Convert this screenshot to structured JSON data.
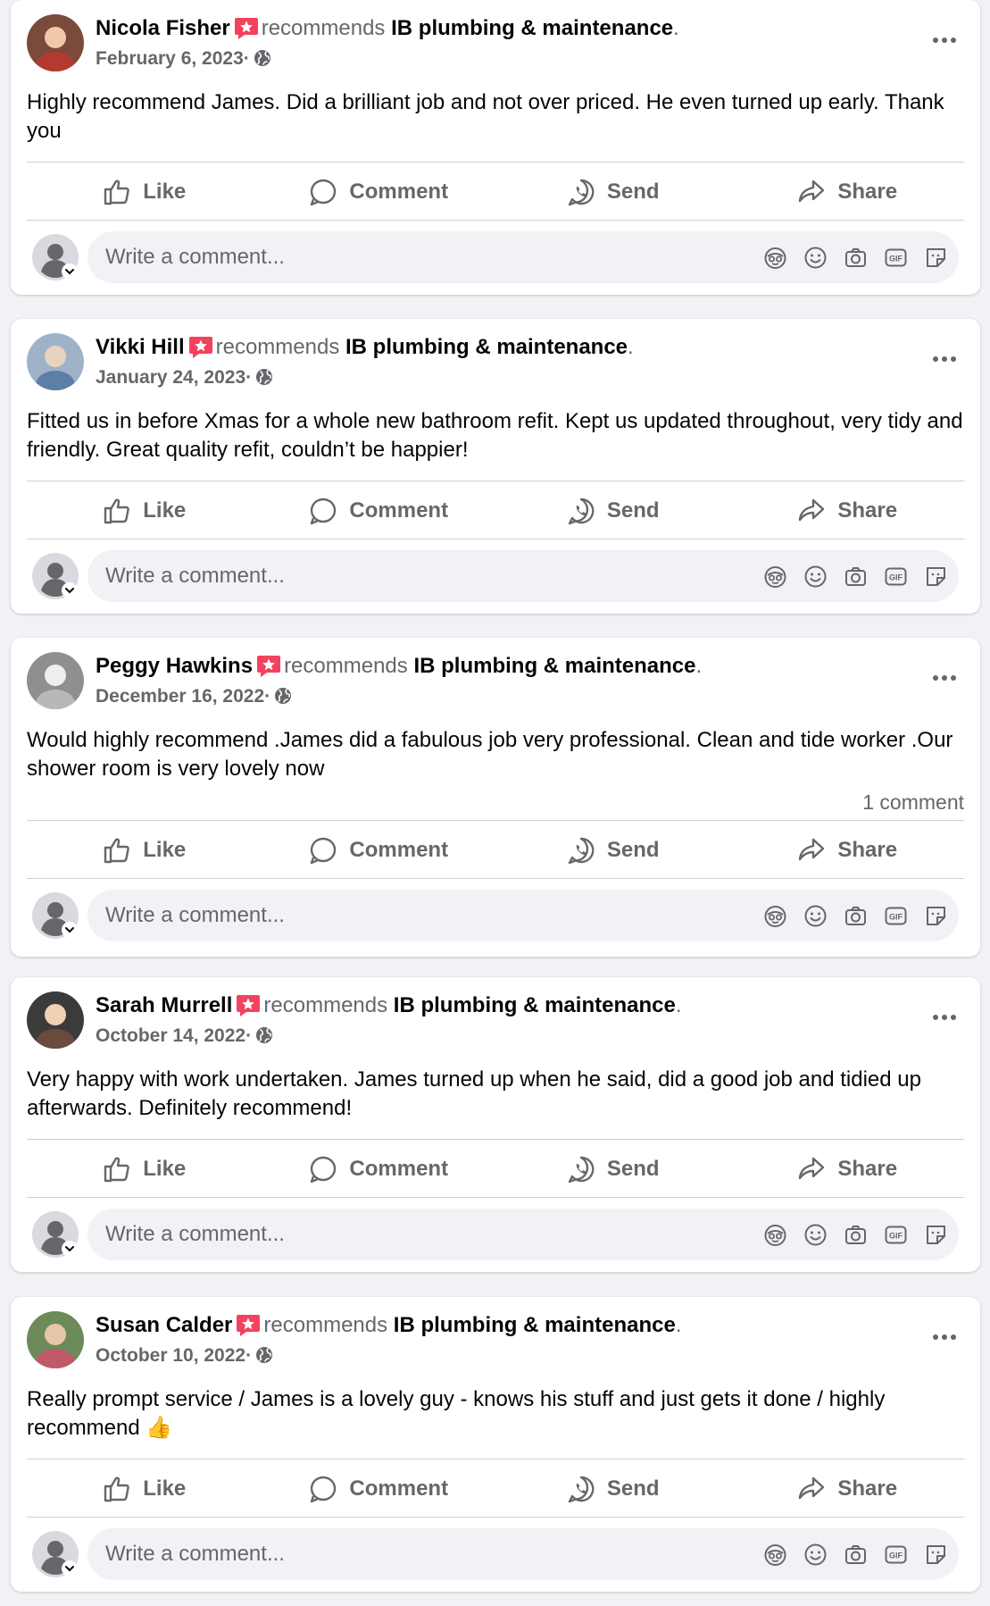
{
  "posts": [
    {
      "author": "Nicola Fisher",
      "verb": "recommends",
      "page": "IB plumbing & maintenance",
      "period": ".",
      "date": "February 6, 2023",
      "date_sep": "·",
      "text": "Highly recommend James. Did a brilliant job  and not over priced. He even turned up early. Thank you",
      "comment_count": "",
      "avatar_icon": "user-photo-icon"
    },
    {
      "author": "Vikki Hill",
      "verb": "recommends",
      "page": "IB plumbing & maintenance",
      "period": ".",
      "date": "January 24, 2023",
      "date_sep": "·",
      "text": "Fitted us in before Xmas for a whole new bathroom refit. Kept us updated throughout, very tidy and friendly. Great quality refit, couldn’t be happier!",
      "comment_count": "",
      "avatar_icon": "user-photo-icon"
    },
    {
      "author": "Peggy Hawkins",
      "verb": "recommends",
      "page": "IB plumbing & maintenance",
      "period": ".",
      "date": "December 16, 2022",
      "date_sep": "·",
      "text": "Would highly recommend .James did a fabulous job very professional. Clean and tide worker .Our shower room is very lovely now",
      "comment_count": "1 comment",
      "avatar_icon": "user-photo-icon"
    },
    {
      "author": "Sarah Murrell",
      "verb": "recommends",
      "page": "IB plumbing & maintenance",
      "period": ".",
      "date": "October 14, 2022",
      "date_sep": "·",
      "text": "Very happy with work undertaken. James turned up when he said, did a good job and tidied up afterwards. Definitely recommend!",
      "comment_count": "",
      "avatar_icon": "user-photo-icon"
    },
    {
      "author": "Susan Calder",
      "verb": "recommends",
      "page": "IB plumbing & maintenance",
      "period": ".",
      "date": "October 10, 2022",
      "date_sep": "·",
      "text": "Really prompt service / James is a lovely guy - knows his stuff and just gets it done / highly recommend 👍",
      "comment_count": "",
      "avatar_icon": "user-photo-icon"
    }
  ],
  "actions": {
    "like": "Like",
    "comment": "Comment",
    "send": "Send",
    "share": "Share"
  },
  "composer": {
    "placeholder": "Write a comment...",
    "icons": [
      "avatar-sticker-icon",
      "emoji-icon",
      "camera-icon",
      "gif-icon",
      "sticker-icon"
    ]
  },
  "icons": {
    "more": "more-options-icon",
    "globe": "globe-icon",
    "recommend_badge": "recommend-star-icon",
    "like": "thumbs-up-icon",
    "comment": "comment-bubble-icon",
    "send": "whatsapp-send-icon",
    "share": "share-arrow-icon"
  },
  "colors": {
    "background": "#f0f2f5",
    "card": "#ffffff",
    "text_primary": "#050505",
    "text_secondary": "#65676b",
    "recommend_badge": "#f3425f",
    "divider": "#ced0d4"
  }
}
